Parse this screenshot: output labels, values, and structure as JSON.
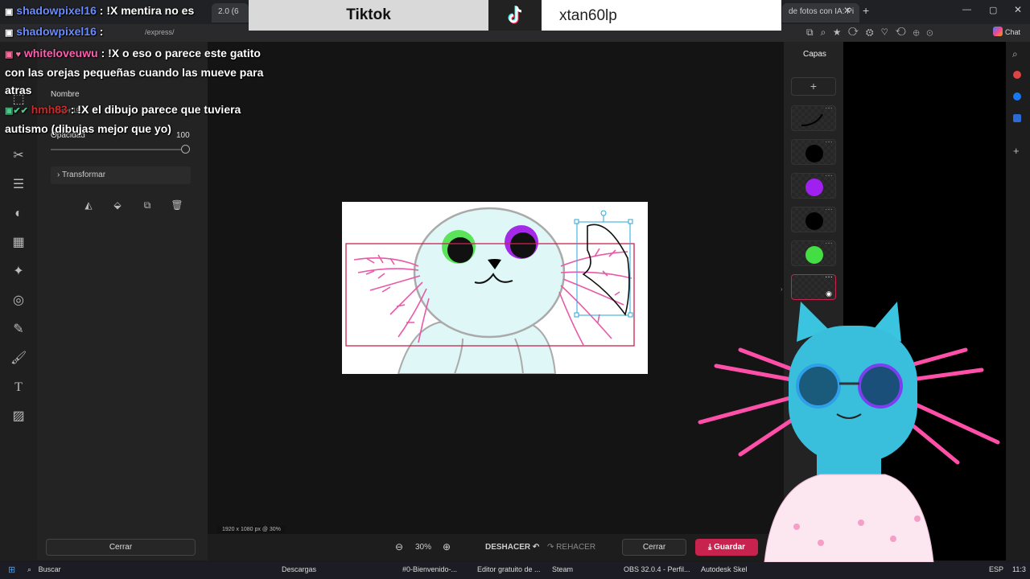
{
  "browser": {
    "tab_label": "de fotos con IA: Pi",
    "tab_label_2": "2.0 (6",
    "address": "/express/",
    "chat_label": "Chat"
  },
  "tiktok": {
    "label": "Tiktok",
    "user": "xtan60lp"
  },
  "chat": [
    {
      "user": "shadowpixel16",
      "text": ": !X mentira no es"
    },
    {
      "user": "shadowpixel16",
      "text": ":"
    },
    {
      "user": "whiteloveuwu",
      "text": ": !X o eso o parece este gatito con las orejas pequeñas cuando las mueve para atras"
    },
    {
      "user": "hmh83",
      "text": ": !X el dibujo parece que tuviera autismo (dibujas mejor que yo)"
    }
  ],
  "panel": {
    "name_label": "Nombre",
    "layer_name": "Layer 19",
    "opacity_label": "Opacidad",
    "opacity_value": "100",
    "opacity_fraction": 1.0,
    "transform_label": "Transformar",
    "close_label": "Cerrar"
  },
  "canvas": {
    "resolution_label": "1920 x 1080 px @ 30%"
  },
  "bottom": {
    "zoom": "30%",
    "undo": "DESHACER",
    "redo": "REHACER",
    "close": "Cerrar",
    "save": "Guardar"
  },
  "layers": {
    "title": "Capas",
    "add": "+",
    "swatches": [
      "#2a2a2a",
      "#000000",
      "#a020f0",
      "#000000",
      "#44dd44"
    ],
    "accent": "#c8234f"
  },
  "taskbar": {
    "search": "Buscar",
    "items": [
      "Descargas",
      "#0-Bienvenido-...",
      "Editor gratuito de ...",
      "Steam",
      "OBS 32.0.4 - Perfil...",
      "Autodesk Skel"
    ],
    "lang": "ESP",
    "time": "11:3"
  },
  "icons": [
    "crop-icon",
    "scissors-icon",
    "sliders-icon",
    "contrast-icon",
    "grid-icon",
    "sparkle-icon",
    "spiral-icon",
    "eraser-icon",
    "brush-icon",
    "text-icon",
    "hatch-icon"
  ]
}
